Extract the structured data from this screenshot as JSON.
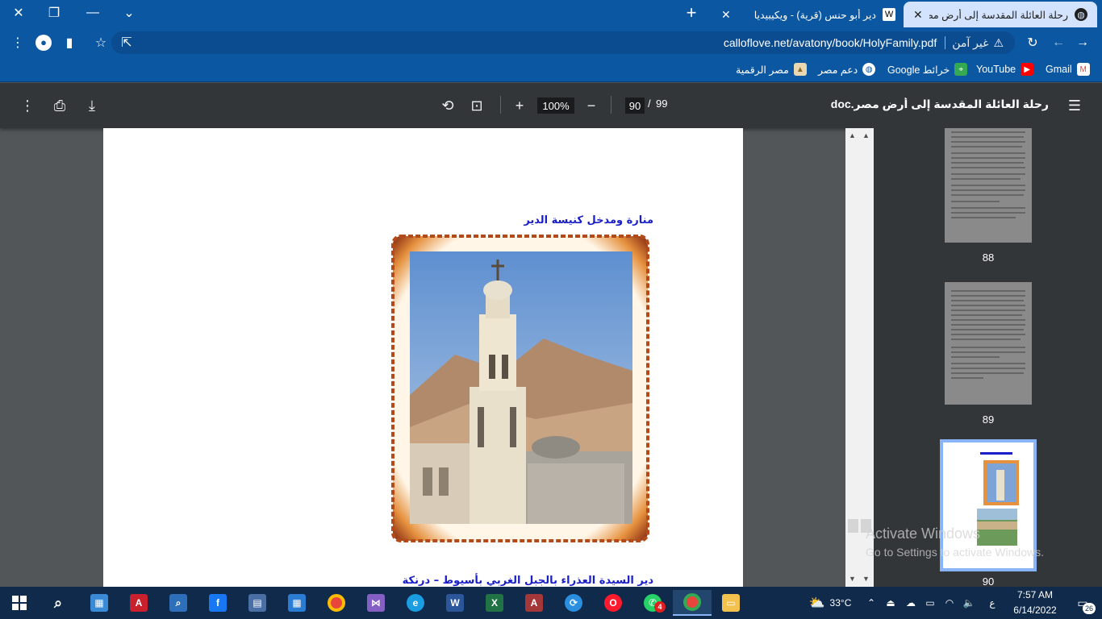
{
  "browser": {
    "tabs": [
      {
        "title": "رحلة العائلة المقدسة إلى أرض مصر",
        "active": true
      },
      {
        "title": "دير أبو حنس (قرية) - ويكيبيديا",
        "icon_text": "W",
        "active": false
      }
    ],
    "new_tab_label": "+",
    "address": {
      "security_label": "غير آمن",
      "url": "calloflove.net/avatony/book/HolyFamily.pdf"
    },
    "bookmarks": [
      {
        "label": "Gmail",
        "icon": "gmail-icon",
        "color": "#ea4335"
      },
      {
        "label": "YouTube",
        "icon": "youtube-icon",
        "color": "#ff0000"
      },
      {
        "label": "خرائط Google",
        "icon": "maps-icon",
        "color": "#34a853"
      },
      {
        "label": "دعم مصر",
        "icon": "globe-icon",
        "color": "#ffffff"
      },
      {
        "label": "مصر الرقمية",
        "icon": "digital-egypt-icon",
        "color": "#d9b26b"
      }
    ]
  },
  "pdf": {
    "title": "رحلة العائلة المقدسة إلى أرض مصر.doc",
    "current_page": "90",
    "page_separator": "/",
    "total_pages": "99",
    "zoom": "100%",
    "captions": {
      "top": "منارة ومدخل كنيسة الدير",
      "bottom": "دير السيدة العذراء بالجبل الغربي بأسيوط – درنكة"
    },
    "thumbnails": [
      {
        "page": "88",
        "kind": "text",
        "selected": false
      },
      {
        "page": "89",
        "kind": "text",
        "selected": false
      },
      {
        "page": "90",
        "kind": "images",
        "selected": true
      }
    ]
  },
  "watermark": {
    "title": "Activate Windows",
    "subtitle": "Go to Settings to activate Windows."
  },
  "taskbar": {
    "weather": "33°C",
    "time": "7:57 AM",
    "date": "6/14/2022",
    "lang": "ع",
    "notifications": "26",
    "whatsapp_badge": "4"
  },
  "colors": {
    "chrome_blue": "#0b57a2",
    "pdf_toolbar": "#323639",
    "caption_blue": "#1a20c8",
    "selected_thumb": "#8ab4f8"
  }
}
